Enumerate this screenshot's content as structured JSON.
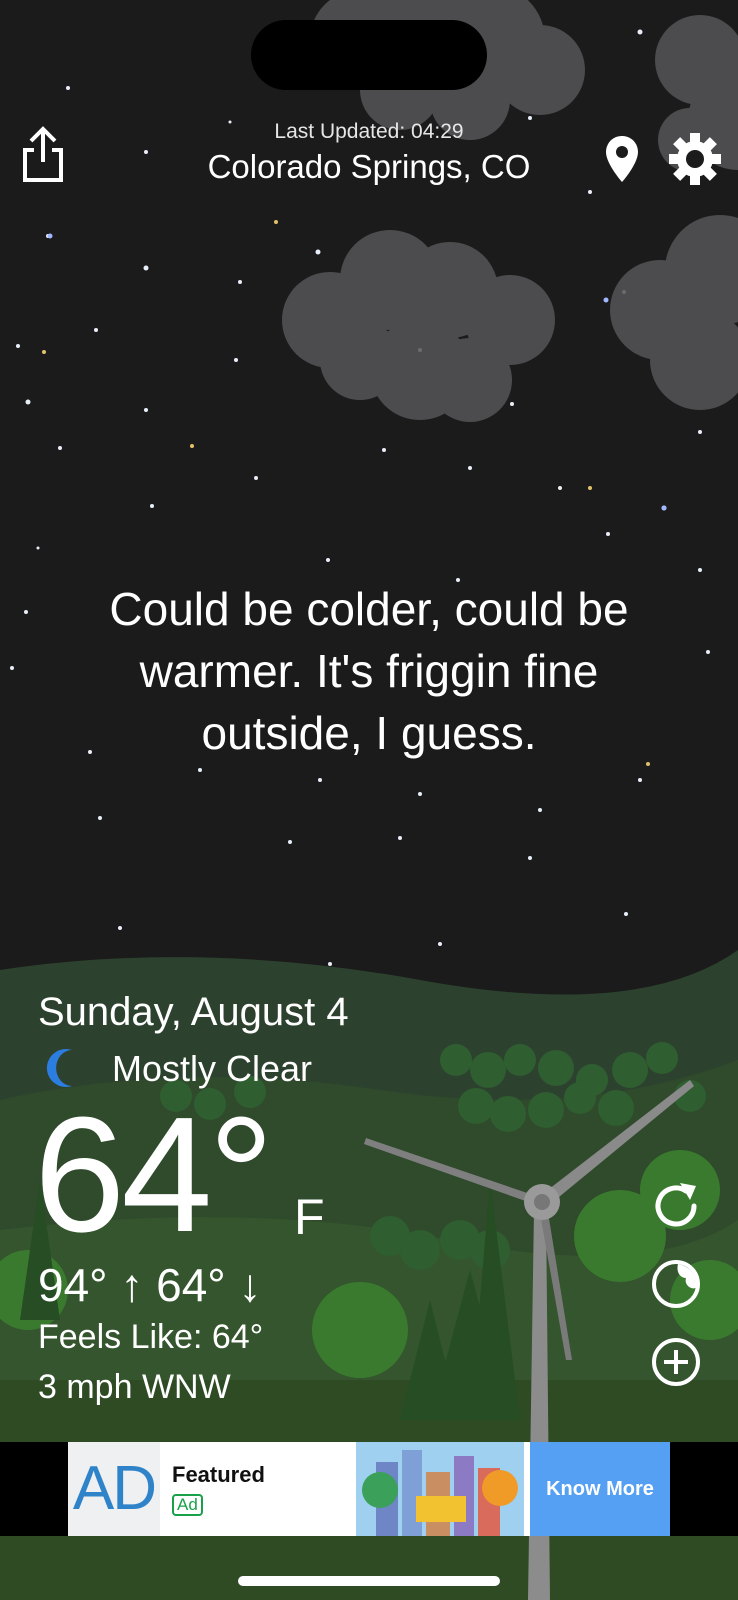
{
  "header": {
    "last_updated": "Last Updated: 04:29",
    "location": "Colorado Springs, CO",
    "share_icon": "share-icon",
    "location_icon": "location-pin-icon",
    "settings_icon": "gear-icon"
  },
  "main": {
    "quote": "Could be colder, could be warmer. It's friggin fine outside, I guess."
  },
  "weather": {
    "date": "Sunday, August 4",
    "condition_icon": "moon-icon",
    "condition": "Mostly Clear",
    "temperature": "64°",
    "unit": "F",
    "hi_lo": "94° ↑ 64° ↓",
    "feels_like": "Feels Like: 64°",
    "wind": "3 mph WNW"
  },
  "side_actions": [
    {
      "icon": "refresh-icon"
    },
    {
      "icon": "radar-icon"
    },
    {
      "icon": "add-icon"
    }
  ],
  "ad": {
    "logo": "AD",
    "title": "Featured",
    "tag": "Ad",
    "cta": "Know More"
  },
  "colors": {
    "sky": "#1b1b1c",
    "hills": "#2f4a2f",
    "accent_moon": "#2c7de0",
    "ad_cta": "#55a0f3"
  }
}
